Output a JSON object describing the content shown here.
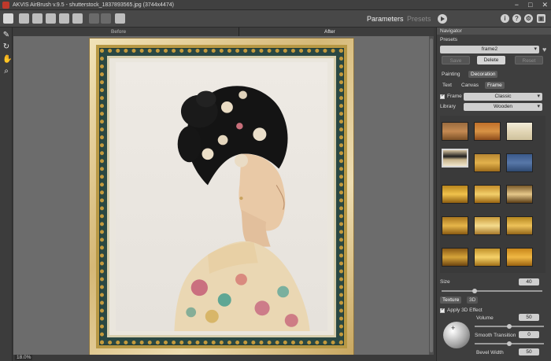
{
  "window": {
    "title": "AKVIS AirBrush v.9.5 - shutterstock_1837893565.jpg (3744x4474)",
    "minimize": "−",
    "maximize": "□",
    "close": "✕"
  },
  "toolbar": {
    "mode_parameters": "Parameters",
    "mode_presets": "Presets",
    "info": "i",
    "help": "?",
    "settings": "⚙",
    "notify": "▣"
  },
  "view_tabs": {
    "before": "Before",
    "after": "After"
  },
  "status": {
    "zoom": "18.0%"
  },
  "left_tools": {
    "brush": "✎",
    "history": "↻",
    "hand": "✋",
    "zoom": "⌕"
  },
  "panel": {
    "navigator": "Navigator",
    "presets_label": "Presets",
    "preset_value": "frame2",
    "save": "Save",
    "delete": "Delete",
    "reset": "Reset",
    "tab_painting": "Painting",
    "tab_decoration": "Decoration",
    "sub_text": "Text",
    "sub_canvas": "Canvas",
    "sub_frame": "Frame",
    "frame_label": "Frame",
    "frame_value": "Classic",
    "library_label": "Library",
    "library_value": "Wooden",
    "size_label": "Size",
    "size_value": "40",
    "size_level": 0.33,
    "texture_tab": "Texture",
    "threed_tab": "3D",
    "apply3d_label": "Apply 3D Effect",
    "volume_label": "Volume",
    "volume_value": "50",
    "volume_level": 0.5,
    "smooth_label": "Smooth Transition",
    "smooth_value": "0",
    "smooth_level": 0.5,
    "bevel_label": "Bevel Width",
    "bevel_value": "50"
  },
  "colors": {
    "accent": "#d6b56a",
    "panel_bg": "#3e3e3e",
    "canvas_bg": "#6c6c6c"
  }
}
